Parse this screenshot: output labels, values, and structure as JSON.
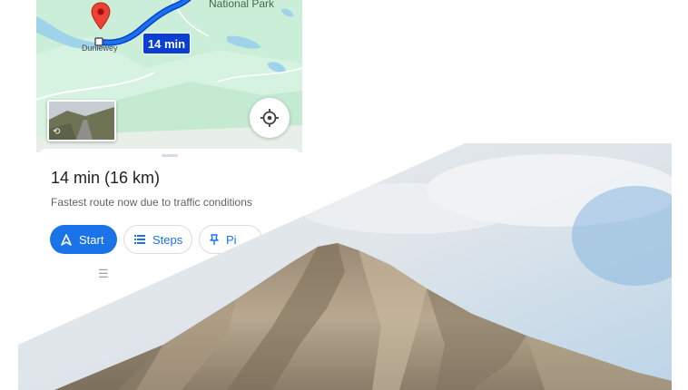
{
  "map": {
    "park_label": "National Park",
    "town_label": "Dunlewey",
    "route_time_chip": "14 min",
    "icons": {
      "destination_pin": "red-map-pin-icon",
      "locate": "crosshair-locate-icon",
      "street_view_rotate": "rotate-360-icon"
    }
  },
  "sheet": {
    "title": "14 min (16 km)",
    "subtitle": "Fastest route now due to traffic conditions",
    "buttons": {
      "start_label": "Start",
      "steps_label": "Steps",
      "pin_label": "Pi"
    },
    "icons": {
      "start": "navigation-arrow-icon",
      "steps": "list-icon",
      "pin": "pushpin-icon",
      "menu": "hamburger-icon"
    },
    "menu_glyph": "☰"
  },
  "colors": {
    "route_blue": "#1a73e8",
    "chip_blue": "#0b3fd1",
    "map_green": "#cbeed8",
    "water_blue": "#9fd3ea",
    "pin_red": "#ea4335"
  }
}
